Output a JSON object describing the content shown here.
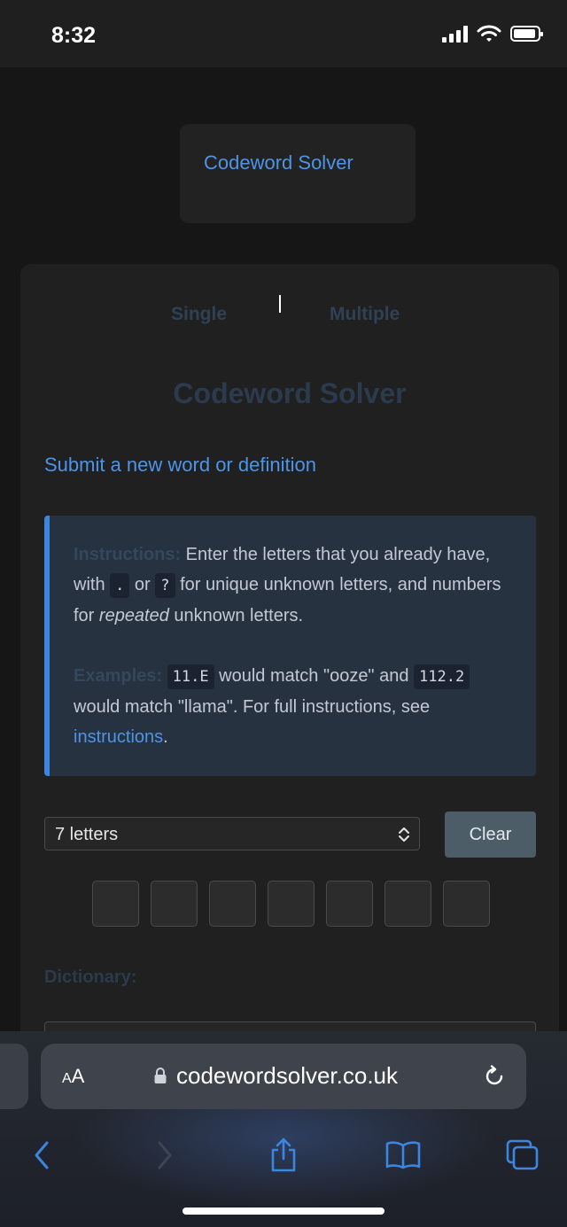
{
  "status_bar": {
    "time": "8:32"
  },
  "site": {
    "logo_text": "Codeword Solver"
  },
  "tabs": [
    {
      "label": "Single"
    },
    {
      "label": "Multiple"
    }
  ],
  "main": {
    "heading": "Codeword Solver",
    "submit_link": "Submit a new word or definition"
  },
  "instructions": {
    "label": "Instructions:",
    "text_1": " Enter the letters that you already have, with ",
    "code_dot": ".",
    "text_or": " or ",
    "code_q": "?",
    "text_2": " for unique unknown letters, and numbers for ",
    "emphasis": "repeated",
    "text_3": " unknown letters.",
    "examples_label": "Examples:",
    "code_ex1": "11.E",
    "text_ex1": " would match \"ooze\" and ",
    "code_ex2": "112.2",
    "text_ex2": " would match \"llama\". For full instructions, see ",
    "link": "instructions",
    "text_end": "."
  },
  "form": {
    "length_select_value": "7 letters",
    "clear_label": "Clear",
    "letter_count": 7,
    "dictionary_label": "Dictionary:"
  },
  "browser": {
    "aa_big": "A",
    "aa_small": "A",
    "url": "codewordsolver.co.uk"
  },
  "colors": {
    "accent": "#4e94e6",
    "background": "#161616",
    "card": "#202020",
    "instructions_bg": "#273241",
    "clear_button": "#4d5d68"
  }
}
